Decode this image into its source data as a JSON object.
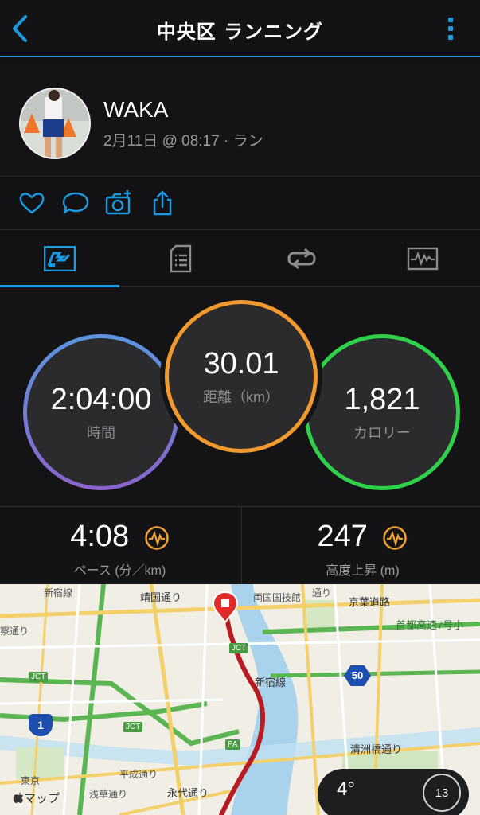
{
  "header": {
    "title": "中央区 ランニング"
  },
  "profile": {
    "name": "WAKA",
    "subtitle": "2月11日 @ 08:17 · ラン"
  },
  "stats": {
    "time": {
      "value": "2:04:00",
      "label": "時間"
    },
    "distance": {
      "value": "30.01",
      "label": "距離（km）"
    },
    "calories": {
      "value": "1,821",
      "label": "カロリー"
    }
  },
  "secondary": {
    "pace": {
      "value": "4:08",
      "label": "ペース (分／km)"
    },
    "elevation": {
      "value": "247",
      "label": "高度上昇 (m)"
    }
  },
  "map": {
    "labels": {
      "l1": "新宿線",
      "l2": "靖国通り",
      "l3": "両国国技館",
      "l4": "通り",
      "l5": "京葉道路",
      "l6": "首都高速7号小",
      "l7": "察通り",
      "l8": "JCT",
      "l9": "新宿線",
      "l10": "50",
      "l11": "JCT",
      "l12": "JCT",
      "l13": "PA",
      "l14": "清洲橋通り",
      "l15": "東京",
      "l16": "平成通り",
      "l17": "永代通り",
      "l18": "浅草通り",
      "l19": "1",
      "l20": "マップ"
    },
    "weather": {
      "temperature": "4°",
      "wind": "13"
    }
  },
  "colors": {
    "accent": "#1a9ae0",
    "time": "#5f87d9",
    "distance": "#f29a2e",
    "calories": "#2fd14a",
    "pace_icon": "#f2a32e"
  }
}
